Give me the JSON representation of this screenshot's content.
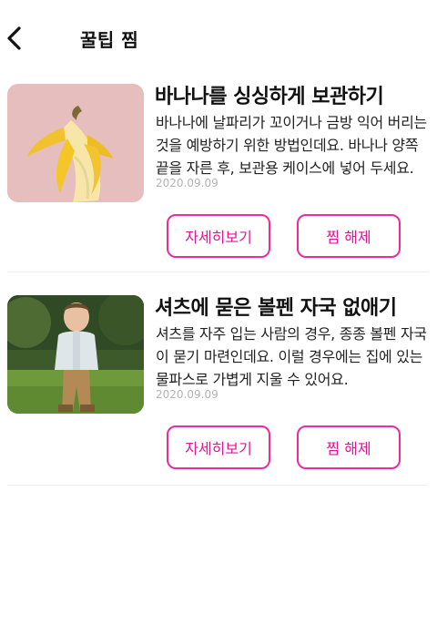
{
  "header": {
    "title": "꿀팁 찜"
  },
  "tips": [
    {
      "title": "바나나를 싱싱하게 보관하기",
      "description": "바나나에 날파리가 꼬이거나 금방 익어 버리는 것을 예방하기 위한 방법인데요. 바나나 양쪽 끝을 자른 후, 보관용 케이스에 넣어 두세요.",
      "date": "2020.09.09",
      "detail_label": "자세히보기",
      "unfavorite_label": "찜 해제"
    },
    {
      "title": "셔츠에 묻은 볼펜 자국 없애기",
      "description": "셔츠를 자주 입는 사람의 경우, 종종 볼펜 자국이 묻기 마련인데요. 이럴 경우에는 집에 있는 물파스로 가볍게 지울 수 있어요.",
      "date": "2020.09.09",
      "detail_label": "자세히보기",
      "unfavorite_label": "찜 해제"
    }
  ],
  "colors": {
    "accent": "#ee2aa0",
    "date": "#b3b3b3",
    "divider": "#eeeeee"
  }
}
